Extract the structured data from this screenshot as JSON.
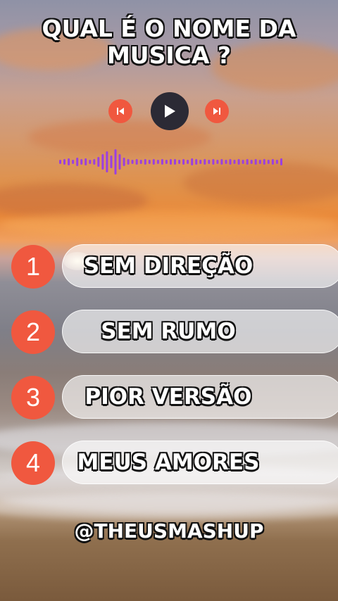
{
  "quiz": {
    "title_line1": "QUAL É O NOME DA",
    "title_line2": "MUSICA ?"
  },
  "player": {
    "prev_icon": "skip-back-icon",
    "play_icon": "play-icon",
    "next_icon": "skip-forward-icon",
    "accent_color": "#f0583f",
    "waveform_color": "#9b3fe0"
  },
  "options": [
    {
      "number": "1",
      "label": "SEM DIREÇÃO"
    },
    {
      "number": "2",
      "label": "SEM RUMO"
    },
    {
      "number": "3",
      "label": "PIOR VERSÃO"
    },
    {
      "number": "4",
      "label": "MEUS AMORES"
    }
  ],
  "footer": {
    "handle": "@THEUSMASHUP"
  }
}
